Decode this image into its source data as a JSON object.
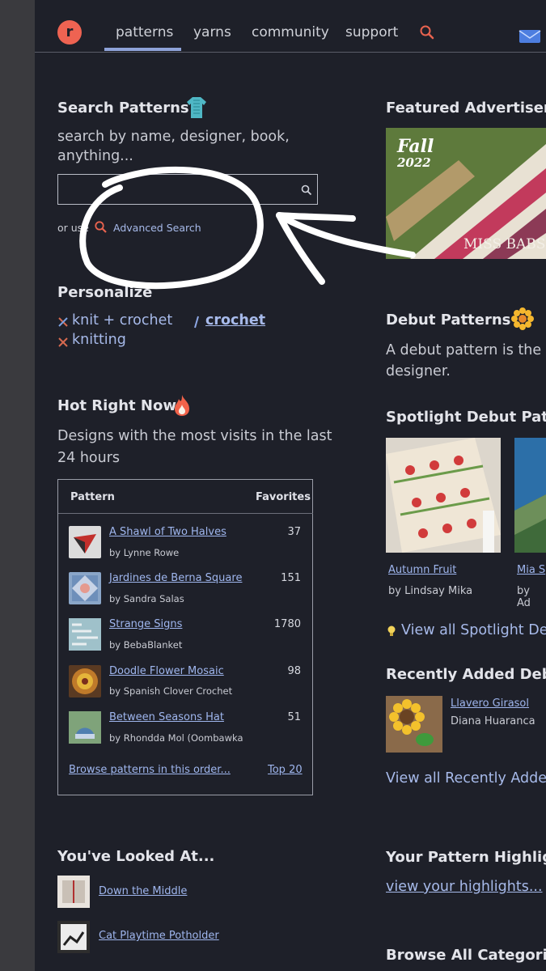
{
  "nav": {
    "logo_letter": "r",
    "items": [
      "patterns",
      "yarns",
      "community",
      "support"
    ]
  },
  "search_patterns": {
    "title": "Search Patterns",
    "description": "search by name, designer, book, anything...",
    "input_value": "",
    "or_use": "or use",
    "advanced_label": "Advanced Search"
  },
  "personalize": {
    "title": "Personalize",
    "knit_crochet": "knit + crochet",
    "crochet": "crochet",
    "knitting": "knitting"
  },
  "hot": {
    "title": "Hot Right Now",
    "description": "Designs with the most visits in the last 24 hours",
    "col_pattern": "Pattern",
    "col_favorites": "Favorites",
    "rows": [
      {
        "title": "A Shawl of Two Halves",
        "by": "by Lynne Rowe",
        "fav": "37"
      },
      {
        "title": "Jardines de Berna Square",
        "by": "by Sandra Salas",
        "fav": "151"
      },
      {
        "title": "Strange Signs",
        "by": "by BebaBlanket",
        "fav": "1780"
      },
      {
        "title": "Doodle Flower Mosaic",
        "by": "by Spanish Clover Crochet",
        "fav": "98"
      },
      {
        "title": "Between Seasons Hat",
        "by": "by Rhondda Mol (Oombawka",
        "fav": "51"
      }
    ],
    "browse_link": "Browse patterns in this order...",
    "top20": "Top 20"
  },
  "looked_at": {
    "title": "You've Looked At...",
    "items": [
      "Down the Middle",
      "Cat Playtime Potholder"
    ]
  },
  "featured": {
    "title": "Featured Advertisers",
    "ad_fall": "Fall",
    "ad_year": "2022",
    "ad_brand": "MISS BABS"
  },
  "debut": {
    "title": "Debut Patterns",
    "description_l1": "A debut pattern is the fi",
    "description_l2": "designer."
  },
  "spotlight": {
    "title": "Spotlight Debut Patte",
    "items": [
      {
        "title": "Autumn Fruit",
        "by": "by Lindsay Mika"
      },
      {
        "title": "Mia S",
        "by": "by Ad"
      }
    ],
    "view_all": "View all Spotlight De"
  },
  "recent": {
    "title": "Recently Added Debu",
    "item_title": "Llavero Girasol",
    "item_by": "Diana Huaranca",
    "view_all": "View all Recently Adde"
  },
  "highlights": {
    "title": "Your Pattern Highligh",
    "link": "view your highlights..."
  },
  "browse_all": {
    "title": "Browse All Categorie"
  }
}
